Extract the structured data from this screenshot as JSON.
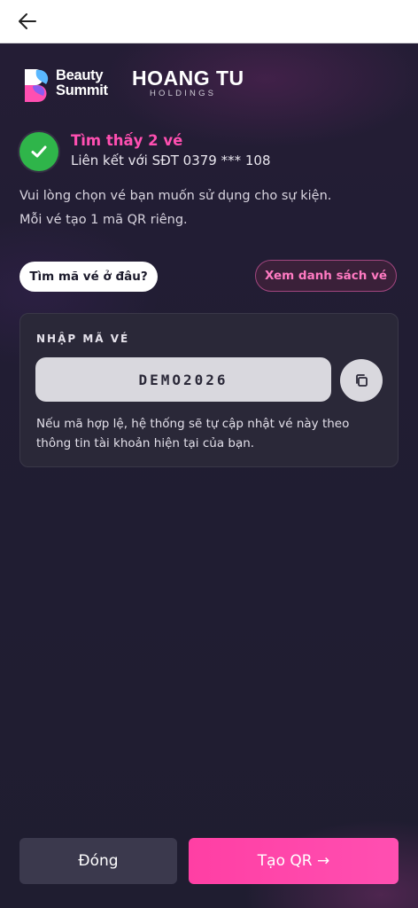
{
  "header": {
    "back_icon": "arrow-left-icon"
  },
  "logos": {
    "beauty_summit": {
      "line1": "Beauty",
      "line2": "Summit"
    },
    "hoang_tu": {
      "main": "HOANG TU",
      "sub": "HOLDINGS"
    }
  },
  "status": {
    "icon": "check-icon",
    "title": "Tìm thấy 2 vé",
    "subtitle": "Liên kết với SĐT 0379 *** 108"
  },
  "description": {
    "line1": "Vui lòng chọn vé bạn muốn sử dụng cho sự kiện.",
    "line2": "Mỗi vé tạo 1 mã QR riêng."
  },
  "actions": {
    "find_code_label": "Tìm mã vé ở đâu?",
    "view_list_label": "Xem danh sách vé"
  },
  "ticket_form": {
    "label": "NHẬP MÃ VÉ",
    "code_value": "DEMO2026",
    "copy_icon": "copy-icon",
    "note": "Nếu mã hợp lệ, hệ thống sẽ tự cập nhật vé này theo thông tin tài khoản hiện tại của bạn."
  },
  "footer": {
    "close_label": "Đóng",
    "create_qr_label": "Tạo QR →"
  },
  "colors": {
    "accent": "#ff4fb1",
    "success": "#2fb54a",
    "background": "#1f1d30",
    "card": "#2a2838"
  }
}
